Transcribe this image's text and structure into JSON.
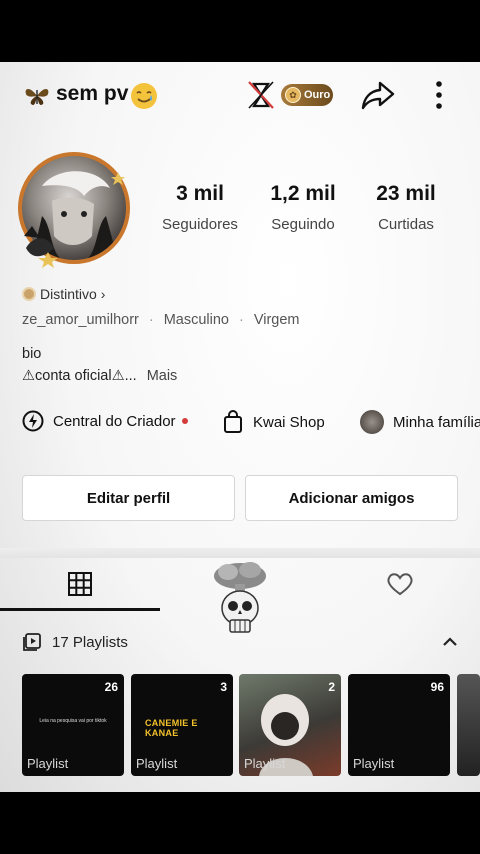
{
  "header": {
    "title": "sem pv",
    "badge_label": "Ouro"
  },
  "stats": [
    {
      "value": "3 mil",
      "label": "Seguidores"
    },
    {
      "value": "1,2 mil",
      "label": "Seguindo"
    },
    {
      "value": "23 mil",
      "label": "Curtidas"
    }
  ],
  "profile": {
    "badge_link": "Distintivo",
    "username": "ze_amor_umilhorr",
    "gender": "Masculino",
    "sign": "Virgem",
    "bio_title": "bio",
    "bio_text": "⚠conta oficial⚠...",
    "more": "Mais"
  },
  "links": [
    {
      "label": "Central do Criador"
    },
    {
      "label": "Kwai Shop"
    },
    {
      "label": "Minha família"
    }
  ],
  "buttons": {
    "edit": "Editar perfil",
    "add_friends": "Adicionar amigos"
  },
  "playlists": {
    "label": "17 Playlists",
    "items": [
      {
        "count": "26",
        "caption": "Playlist",
        "thumb_text": "Leia na pesquisa\nvai por tiktok"
      },
      {
        "count": "3",
        "caption": "Playlist",
        "thumb_text": "CANEMIE E KANAE"
      },
      {
        "count": "2",
        "caption": "Playlist"
      },
      {
        "count": "96",
        "caption": "Playlist"
      }
    ]
  },
  "colors": {
    "accent_gold": "#c9a36a",
    "avatar_ring": "#c9772c",
    "dot_red": "#d43c3c"
  }
}
